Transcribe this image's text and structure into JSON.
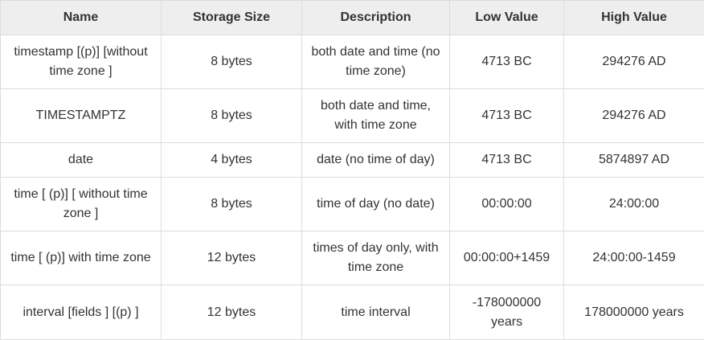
{
  "table": {
    "headers": [
      "Name",
      "Storage Size",
      "Description",
      "Low Value",
      "High Value"
    ],
    "rows": [
      [
        "timestamp [(p)] [without time zone ]",
        "8 bytes",
        "both date and time (no time zone)",
        "4713 BC",
        "294276 AD"
      ],
      [
        "TIMESTAMPTZ",
        "8 bytes",
        "both date and time, with time zone",
        "4713 BC",
        "294276 AD"
      ],
      [
        "date",
        "4 bytes",
        "date (no time of day)",
        "4713 BC",
        "5874897 AD"
      ],
      [
        "time [ (p)] [ without time zone ]",
        "8 bytes",
        "time of day (no date)",
        "00:00:00",
        "24:00:00"
      ],
      [
        "time [ (p)] with time zone",
        "12 bytes",
        "times of day only, with time zone",
        "00:00:00+1459",
        "24:00:00-1459"
      ],
      [
        "interval [fields ] [(p) ]",
        "12 bytes",
        "time interval",
        "-178000000 years",
        "178000000 years"
      ]
    ]
  }
}
